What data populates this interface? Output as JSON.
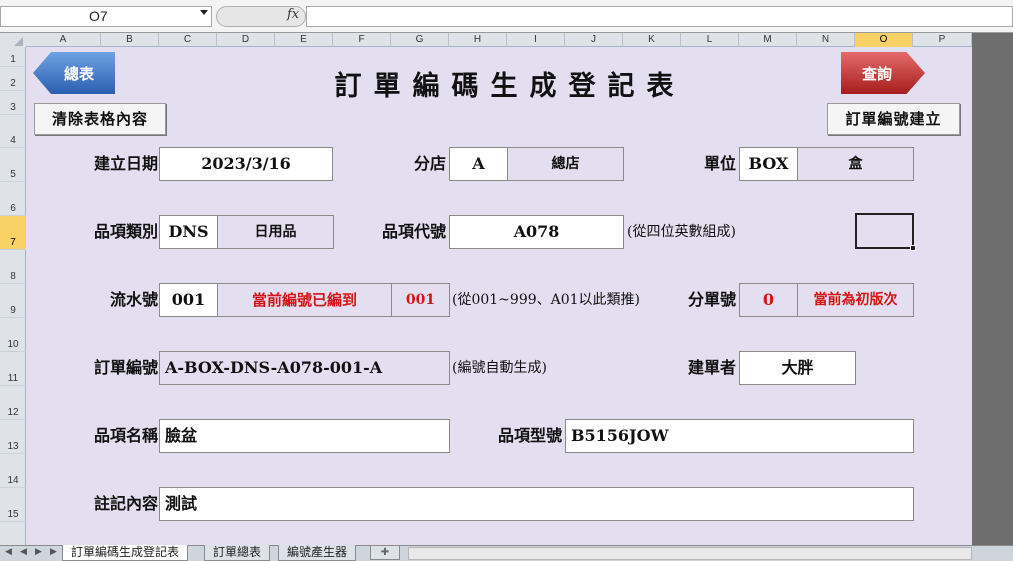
{
  "formula_bar": {
    "name_box": "O7",
    "fx_label": "fx",
    "formula": ""
  },
  "columns": [
    "A",
    "B",
    "C",
    "D",
    "E",
    "F",
    "G",
    "H",
    "I",
    "J",
    "K",
    "L",
    "M",
    "N",
    "O",
    "P"
  ],
  "rows": [
    "1",
    "2",
    "3",
    "4",
    "5",
    "6",
    "7",
    "8",
    "9",
    "10",
    "11",
    "12",
    "13",
    "14",
    "15"
  ],
  "selected": {
    "column": "O",
    "row": "7"
  },
  "title": "訂單編碼生成登記表",
  "buttons": {
    "summary": "總表",
    "query": "查詢",
    "clear": "清除表格內容",
    "create": "訂單編號建立"
  },
  "form": {
    "date_label": "建立日期",
    "date_value": "2023/3/16",
    "branch_label": "分店",
    "branch_code": "A",
    "branch_name": "總店",
    "unit_label": "單位",
    "unit_code": "BOX",
    "unit_name": "盒",
    "category_label": "品項類別",
    "category_code": "DNS",
    "category_name": "日用品",
    "item_code_label": "品項代號",
    "item_code_value": "A078",
    "item_code_note": "(從四位英數組成)",
    "serial_label": "流水號",
    "serial_value": "001",
    "serial_status": "當前編號已編到",
    "serial_current": "001",
    "serial_note": "(從001~999、A01以此類推)",
    "sub_label": "分單號",
    "sub_value": "0",
    "sub_status": "當前為初版次",
    "order_label": "訂單編號",
    "order_value": "A-BOX-DNS-A078-001-A",
    "order_note": "(編號自動生成)",
    "creator_label": "建單者",
    "creator_value": "大胖",
    "item_name_label": "品項名稱",
    "item_name_value": "臉盆",
    "model_label": "品項型號",
    "model_value": "B5156JOW",
    "remark_label": "註記內容",
    "remark_value": "測試"
  },
  "sheet_tabs": [
    "訂單編碼生成登記表",
    "訂單總表",
    "編號產生器"
  ],
  "colors": {
    "sheet_bg": "#e4dff0",
    "summary_btn": "#3a6fc0",
    "query_btn": "#c02a2a",
    "status_red": "#d41515"
  }
}
